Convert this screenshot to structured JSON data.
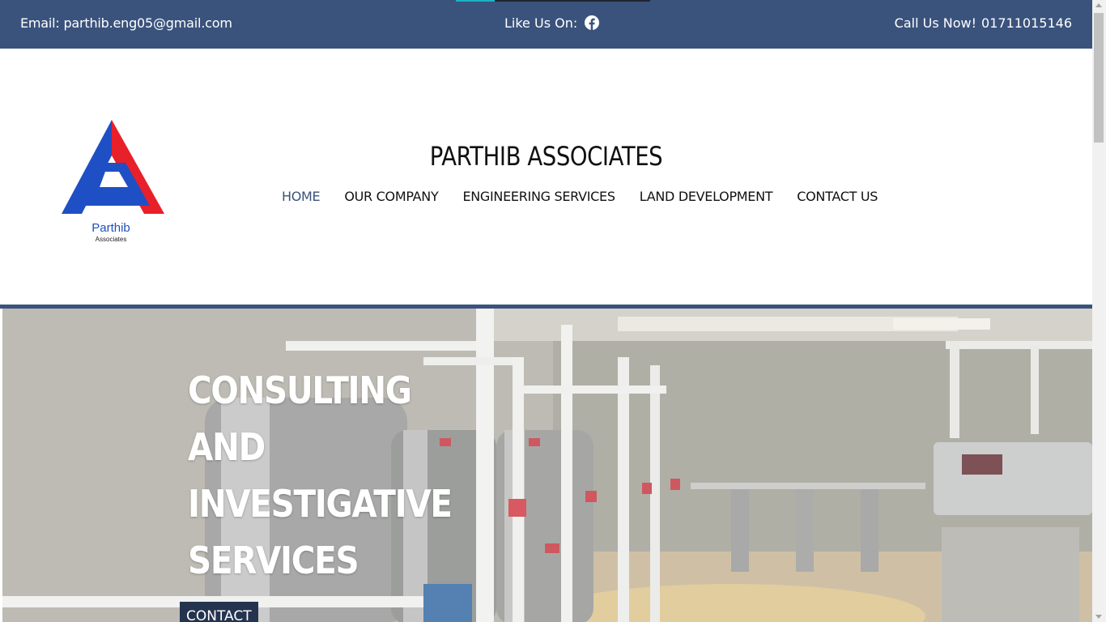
{
  "topbar": {
    "email": "Email: parthib.eng05@gmail.com",
    "like_label": "Like Us On:",
    "like_icon": "facebook-icon",
    "call_label": "Call Us Now!",
    "phone": "01711015146"
  },
  "header": {
    "logo": {
      "name": "Parthib",
      "subtitle": "Associates"
    },
    "site_title": "PARTHIB ASSOCIATES"
  },
  "nav": {
    "items": [
      {
        "label": "HOME",
        "active": true
      },
      {
        "label": "OUR COMPANY",
        "active": false
      },
      {
        "label": "ENGINEERING SERVICES",
        "active": false
      },
      {
        "label": "LAND DEVELOPMENT",
        "active": false
      },
      {
        "label": "CONTACT US",
        "active": false
      }
    ]
  },
  "hero": {
    "lines": [
      "CONSULTING",
      "AND",
      "INVESTIGATIVE",
      "SERVICES"
    ],
    "button_label": "CONTACT"
  },
  "colors": {
    "brand": "#3a537c",
    "button": "#24344f",
    "logo_red": "#e8202a",
    "logo_blue": "#1f4fc4"
  }
}
